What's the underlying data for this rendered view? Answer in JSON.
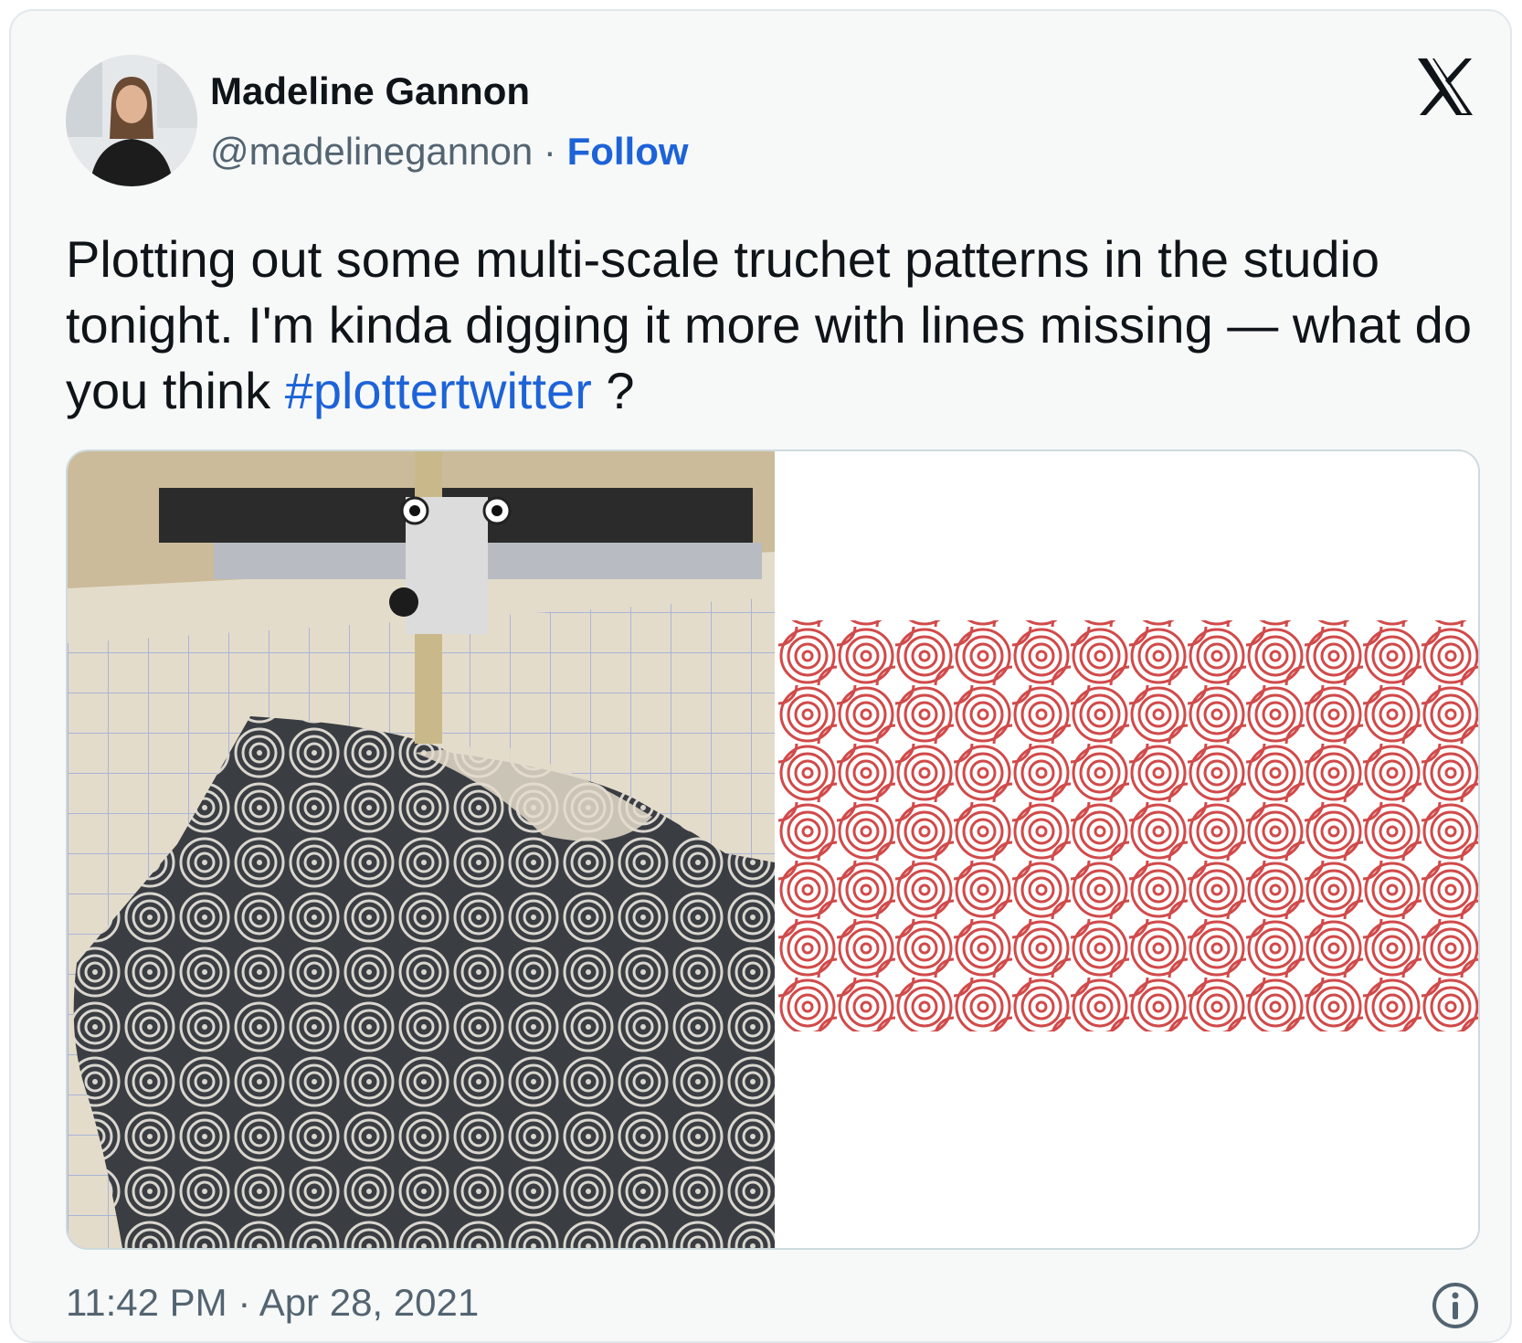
{
  "tweet": {
    "author_name": "Madeline Gannon",
    "handle": "@madelinegannon",
    "separator": "·",
    "follow_label": "Follow",
    "text_main": "Plotting out some multi-scale truchet patterns in the studio tonight. I'm kinda digging it more with lines missing — what do you think ",
    "hashtag": "#plottertwitter",
    "text_tail": " ?",
    "time": "11:42 PM",
    "date_separator": "·",
    "date": "Apr 28, 2021"
  },
  "icons": {
    "brand": "x-logo-icon",
    "info": "info-icon"
  },
  "colors": {
    "link_blue": "#1d63d8",
    "pattern_red": "#d14a4a",
    "text_dark": "#0f1419",
    "text_muted": "#536471",
    "card_background": "#f7f9f9"
  }
}
